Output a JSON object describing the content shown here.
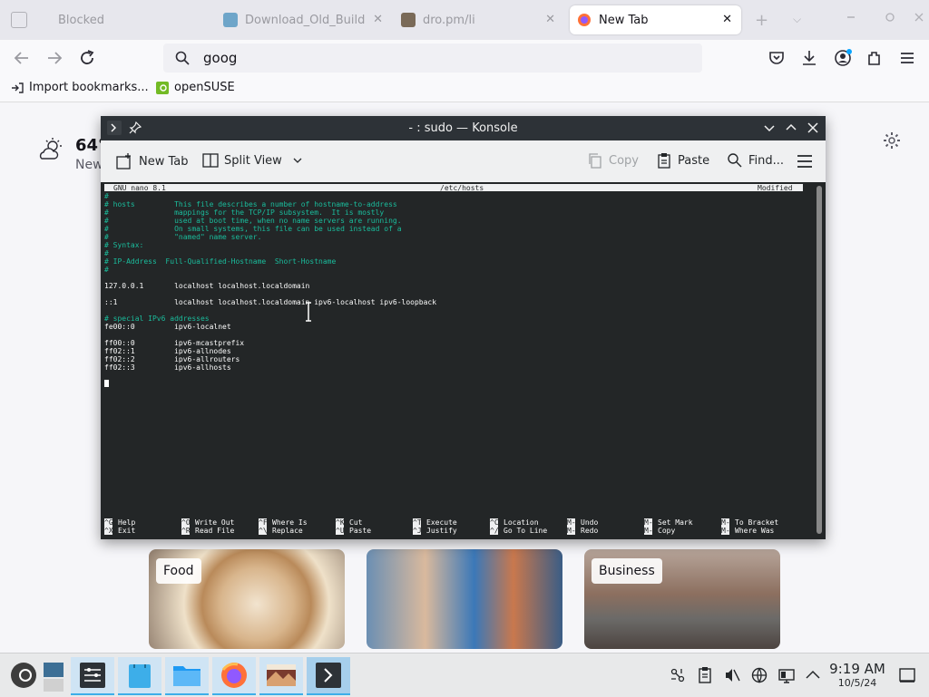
{
  "browser": {
    "tabs": [
      {
        "label": "Blocked"
      },
      {
        "label": "Download_Old_Build"
      },
      {
        "label": "dro.pm/li"
      },
      {
        "label": "New Tab"
      }
    ],
    "new_tab_symbol": "+",
    "list_tabs_symbol": "⌵",
    "tab_close_symbol": "✕",
    "url_value": "goog",
    "bookmarks": [
      {
        "label": "Import bookmarks..."
      },
      {
        "label": "openSUSE"
      }
    ]
  },
  "newtab": {
    "weather_temp": "64°",
    "weather_location": "New",
    "cards": [
      {
        "label": "Food"
      },
      {
        "label": ""
      },
      {
        "label": "Business"
      }
    ]
  },
  "konsole": {
    "title": "- : sudo — Konsole",
    "toolbar": {
      "new_tab": "New Tab",
      "split_view": "Split View",
      "copy": "Copy",
      "paste": "Paste",
      "find": "Find..."
    },
    "nano": {
      "version": "GNU nano 8.1",
      "file": "/etc/hosts",
      "status": "Modified",
      "lines": [
        {
          "text": "#",
          "comment": true
        },
        {
          "text": "# hosts         This file describes a number of hostname-to-address",
          "comment": true
        },
        {
          "text": "#               mappings for the TCP/IP subsystem.  It is mostly",
          "comment": true
        },
        {
          "text": "#               used at boot time, when no name servers are running.",
          "comment": true
        },
        {
          "text": "#               On small systems, this file can be used instead of a",
          "comment": true
        },
        {
          "text": "#               \"named\" name server.",
          "comment": true
        },
        {
          "text": "# Syntax:",
          "comment": true
        },
        {
          "text": "#",
          "comment": true
        },
        {
          "text": "# IP-Address  Full-Qualified-Hostname  Short-Hostname",
          "comment": true
        },
        {
          "text": "#",
          "comment": true
        },
        {
          "text": "",
          "comment": false
        },
        {
          "text": "127.0.0.1       localhost localhost.localdomain",
          "comment": false
        },
        {
          "text": "",
          "comment": false
        },
        {
          "text": "::1             localhost localhost.localdomain ipv6-localhost ipv6-loopback",
          "comment": false
        },
        {
          "text": "",
          "comment": false
        },
        {
          "text": "# special IPv6 addresses",
          "comment": true
        },
        {
          "text": "fe00::0         ipv6-localnet",
          "comment": false
        },
        {
          "text": "",
          "comment": false
        },
        {
          "text": "ff00::0         ipv6-mcastprefix",
          "comment": false
        },
        {
          "text": "ff02::1         ipv6-allnodes",
          "comment": false
        },
        {
          "text": "ff02::2         ipv6-allrouters",
          "comment": false
        },
        {
          "text": "ff02::3         ipv6-allhosts",
          "comment": false
        }
      ],
      "shortcuts": [
        {
          "k1": "^G",
          "l1": "Help",
          "k2": "^X",
          "l2": "Exit"
        },
        {
          "k1": "^O",
          "l1": "Write Out",
          "k2": "^R",
          "l2": "Read File"
        },
        {
          "k1": "^F",
          "l1": "Where Is",
          "k2": "^\\",
          "l2": "Replace"
        },
        {
          "k1": "^K",
          "l1": "Cut",
          "k2": "^U",
          "l2": "Paste"
        },
        {
          "k1": "^T",
          "l1": "Execute",
          "k2": "^J",
          "l2": "Justify"
        },
        {
          "k1": "^C",
          "l1": "Location",
          "k2": "^/",
          "l2": "Go To Line"
        },
        {
          "k1": "M-U",
          "l1": "Undo",
          "k2": "M-E",
          "l2": "Redo"
        },
        {
          "k1": "M-A",
          "l1": "Set Mark",
          "k2": "M-6",
          "l2": "Copy"
        },
        {
          "k1": "M-]",
          "l1": "To Bracket",
          "k2": "M-Q",
          "l2": "Where Was"
        }
      ]
    }
  },
  "taskbar": {
    "time": "9:19 AM",
    "date": "10/5/24"
  },
  "colors": {
    "comment": "#1abc9c",
    "terminal_bg": "#232627",
    "accent": "#3daee9"
  }
}
